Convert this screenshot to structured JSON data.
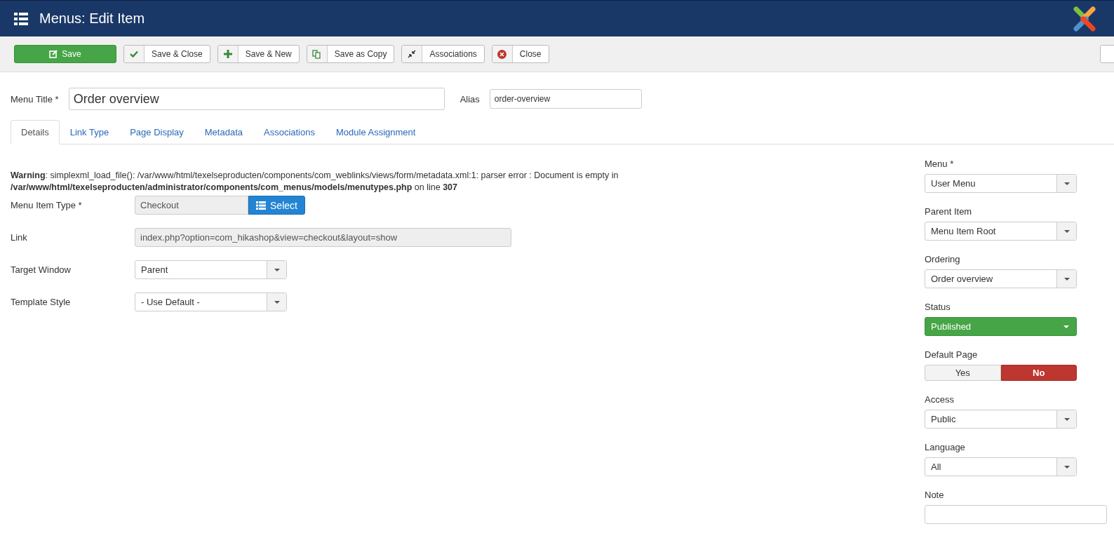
{
  "header": {
    "title": "Menus: Edit Item"
  },
  "toolbar": [
    {
      "label": "Save",
      "kind": "primary"
    },
    {
      "label": "Save & Close",
      "kind": "default"
    },
    {
      "label": "Save & New",
      "kind": "default"
    },
    {
      "label": "Save as Copy",
      "kind": "default"
    },
    {
      "label": "Associations",
      "kind": "default"
    },
    {
      "label": "Close",
      "kind": "default"
    }
  ],
  "title_field": {
    "label": "Menu Title *",
    "value": "Order overview"
  },
  "alias_field": {
    "label": "Alias",
    "value": "order-overview"
  },
  "tabs": [
    {
      "label": "Details",
      "selected": true
    },
    {
      "label": "Link Type",
      "selected": false
    },
    {
      "label": "Page Display",
      "selected": false
    },
    {
      "label": "Metadata",
      "selected": false
    },
    {
      "label": "Associations",
      "selected": false
    },
    {
      "label": "Module Assignment",
      "selected": false
    }
  ],
  "warning": [
    "**Warning**: simplexml_load_file(): /var/www/html/texelseproducten/components/com_weblinks/views/form/metadata.xml:1: parser error : Document is empty in",
    "**/var/www/html/texelseproducten/administrator/components/com_menus/models/menutypes.php** on line **307**"
  ],
  "fields": [
    {
      "label": "Menu Item Type *",
      "kind": "picker",
      "value": "Checkout",
      "button": "Select"
    },
    {
      "label": "Link",
      "kind": "readonly",
      "value": "index.php?option=com_hikashop&view=checkout&layout=show"
    },
    {
      "label": "Target Window",
      "kind": "select",
      "value": "Parent"
    },
    {
      "label": "Template Style",
      "kind": "select",
      "value": "- Use Default -"
    }
  ],
  "sidebar": [
    {
      "label": "Menu *",
      "kind": "select",
      "value": "User Menu"
    },
    {
      "label": "Parent Item",
      "kind": "select",
      "value": "Menu Item Root"
    },
    {
      "label": "Ordering",
      "kind": "select",
      "value": "Order overview"
    },
    {
      "label": "Status",
      "kind": "status",
      "value": "Published"
    },
    {
      "label": "Default Page",
      "kind": "toggle",
      "options": [
        {
          "label": "Yes",
          "selected": false
        },
        {
          "label": "No",
          "selected": true
        }
      ]
    },
    {
      "label": "Access",
      "kind": "select",
      "value": "Public"
    },
    {
      "label": "Language",
      "kind": "select",
      "value": "All"
    },
    {
      "label": "Note",
      "kind": "text"
    }
  ]
}
